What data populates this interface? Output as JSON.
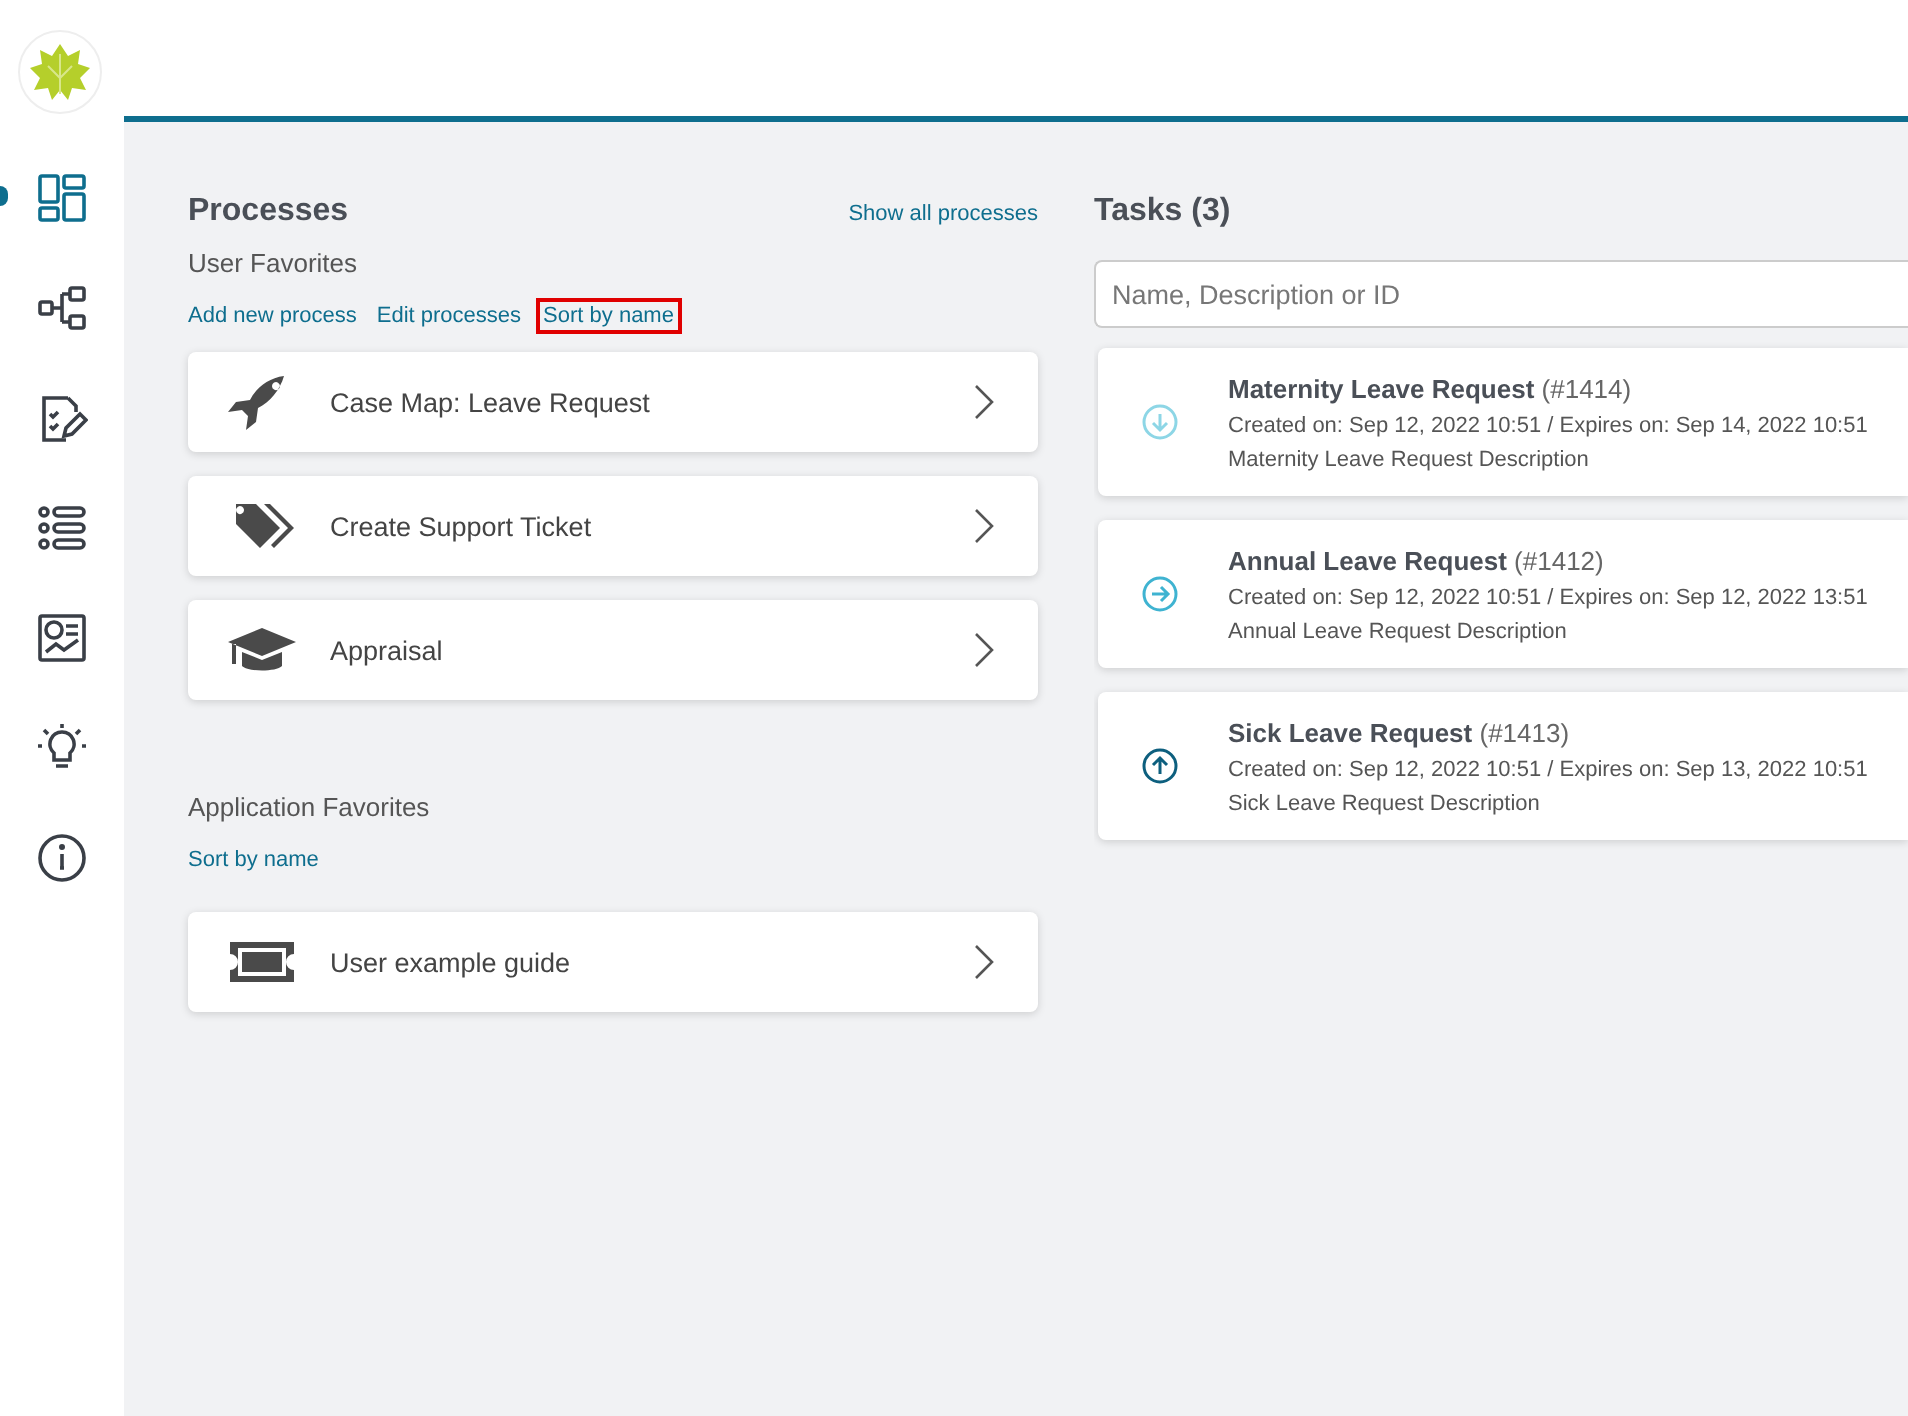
{
  "sidebar": {
    "items": [
      {
        "kind": "dashboard",
        "selected": true
      },
      {
        "kind": "flow",
        "selected": false
      },
      {
        "kind": "checklist",
        "selected": false
      },
      {
        "kind": "list",
        "selected": false
      },
      {
        "kind": "report",
        "selected": false
      },
      {
        "kind": "idea",
        "selected": false
      },
      {
        "kind": "info",
        "selected": false
      }
    ]
  },
  "processes": {
    "title": "Processes",
    "show_all": "Show all processes",
    "user_favorites": {
      "heading": "User Favorites",
      "actions": [
        {
          "label": "Add new process",
          "highlighted": false
        },
        {
          "label": "Edit processes",
          "highlighted": false
        },
        {
          "label": "Sort by name",
          "highlighted": true
        }
      ],
      "items": [
        {
          "kind": "rocket",
          "label": "Case Map: Leave Request"
        },
        {
          "kind": "tag",
          "label": "Create Support Ticket"
        },
        {
          "kind": "cap",
          "label": "Appraisal"
        }
      ]
    },
    "application_favorites": {
      "heading": "Application Favorites",
      "actions": [
        {
          "label": "Sort by name",
          "highlighted": false
        }
      ],
      "items": [
        {
          "kind": "ticket",
          "label": "User example guide"
        }
      ]
    }
  },
  "tasks": {
    "title": "Tasks (3)",
    "search": {
      "placeholder": "Name, Description or ID"
    },
    "items": [
      {
        "kind": "down",
        "name": "Maternity Leave Request",
        "id": "(#1414)",
        "dates": "Created on: Sep 12, 2022 10:51 / Expires on: Sep 14, 2022 10:51",
        "description": "Maternity Leave Request Description"
      },
      {
        "kind": "right",
        "name": "Annual Leave Request",
        "id": "(#1412)",
        "dates": "Created on: Sep 12, 2022 10:51 / Expires on: Sep 12, 2022 13:51",
        "description": "Annual Leave Request Description"
      },
      {
        "kind": "up",
        "name": "Sick Leave Request",
        "id": "(#1413)",
        "dates": "Created on: Sep 12, 2022 10:51 / Expires on: Sep 13, 2022 10:51",
        "description": "Sick Leave Request Description"
      }
    ]
  }
}
